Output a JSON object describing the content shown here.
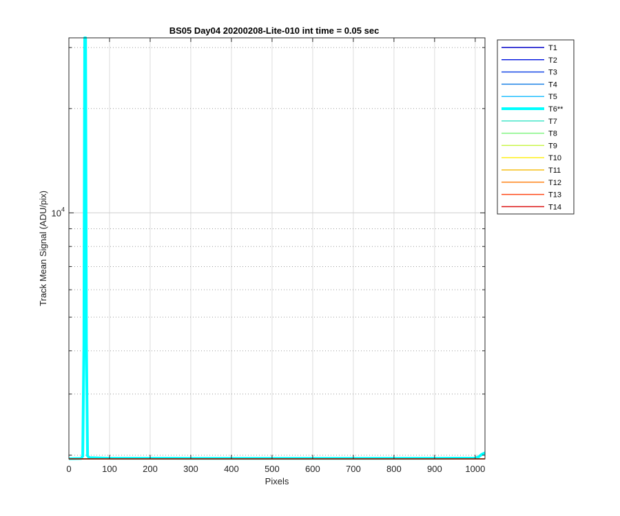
{
  "chart_data": {
    "type": "line",
    "title": "BS05 Day04 20200208-Lite-010 int time = 0.05 sec",
    "xlabel": "Pixels",
    "ylabel": "Track Mean Signal (ADU/pix)",
    "xlim": [
      0,
      1024
    ],
    "ylim": [
      1950,
      32000
    ],
    "yscale": "log",
    "grid": true,
    "legend_position": "outside-right-top",
    "x_ticks": [
      0,
      100,
      200,
      300,
      400,
      500,
      600,
      700,
      800,
      900,
      1000
    ],
    "x_tick_labels": [
      "0",
      "100",
      "200",
      "300",
      "400",
      "500",
      "600",
      "700",
      "800",
      "900",
      "1000"
    ],
    "y_major_ticks": [
      10000
    ],
    "y_major_tick_label_base": "10",
    "y_major_tick_label_exp": "4",
    "y_minor_ticks": [
      2000,
      3000,
      4000,
      5000,
      6000,
      7000,
      8000,
      9000,
      20000,
      30000
    ],
    "series": [
      {
        "name": "T1",
        "color": "#0000c8",
        "width": 1.5,
        "x": [
          0,
          1024
        ],
        "y": [
          1950,
          1950
        ]
      },
      {
        "name": "T2",
        "color": "#0a1ee0",
        "width": 1.5,
        "x": [
          0,
          1024
        ],
        "y": [
          1950,
          1950
        ]
      },
      {
        "name": "T3",
        "color": "#1446e6",
        "width": 1.5,
        "x": [
          0,
          1024
        ],
        "y": [
          1950,
          1950
        ]
      },
      {
        "name": "T4",
        "color": "#1e82e6",
        "width": 1.5,
        "x": [
          0,
          1024
        ],
        "y": [
          1950,
          1950
        ]
      },
      {
        "name": "T5",
        "color": "#1ebeff",
        "width": 1.5,
        "x": [
          0,
          1024
        ],
        "y": [
          1950,
          1950
        ]
      },
      {
        "name": "T6**",
        "color": "#00ffff",
        "width": 4,
        "x": [
          0,
          30,
          34,
          37,
          39,
          41,
          43,
          46,
          50,
          100,
          300,
          600,
          900,
          1000,
          1008,
          1016,
          1024
        ],
        "y": [
          1952,
          1955,
          1985,
          4200,
          32000,
          32000,
          4200,
          1990,
          1965,
          1958,
          1957,
          1956,
          1958,
          1960,
          1975,
          2010,
          2030
        ]
      },
      {
        "name": "T7",
        "color": "#46e6c8",
        "width": 1.5,
        "x": [
          0,
          1024
        ],
        "y": [
          1950,
          1950
        ]
      },
      {
        "name": "T8",
        "color": "#82f582",
        "width": 1.5,
        "x": [
          0,
          1024
        ],
        "y": [
          1950,
          1950
        ]
      },
      {
        "name": "T9",
        "color": "#c8f546",
        "width": 1.5,
        "x": [
          0,
          1024
        ],
        "y": [
          1950,
          1950
        ]
      },
      {
        "name": "T10",
        "color": "#fff01e",
        "width": 1.5,
        "x": [
          0,
          1024
        ],
        "y": [
          1950,
          1950
        ]
      },
      {
        "name": "T11",
        "color": "#f5be14",
        "width": 1.5,
        "x": [
          0,
          1024
        ],
        "y": [
          1950,
          1950
        ]
      },
      {
        "name": "T12",
        "color": "#ff8214",
        "width": 1.5,
        "x": [
          0,
          1024
        ],
        "y": [
          1950,
          1950
        ]
      },
      {
        "name": "T13",
        "color": "#ff4614",
        "width": 1.5,
        "x": [
          0,
          1024
        ],
        "y": [
          1950,
          1950
        ]
      },
      {
        "name": "T14",
        "color": "#dc1414",
        "width": 1.5,
        "x": [
          0,
          1024
        ],
        "y": [
          1950,
          1950
        ]
      }
    ]
  }
}
